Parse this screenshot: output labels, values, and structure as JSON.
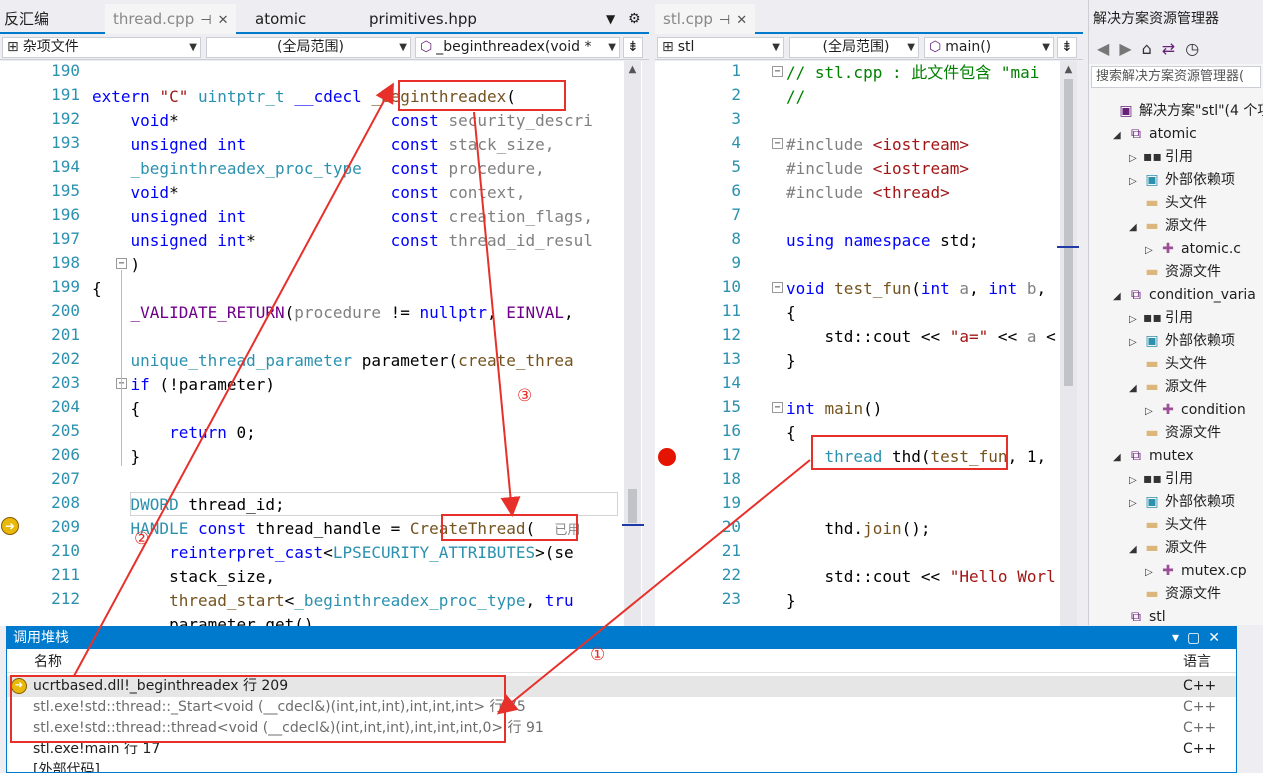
{
  "left_doc": {
    "side_tab": "反汇编",
    "tabs": [
      "thread.cpp",
      "atomic",
      "primitives.hpp"
    ],
    "scope_combo": "杂项文件",
    "range_combo": "(全局范围)",
    "func_combo": "_beginthreadex(void *",
    "line_numbers": [
      "190",
      "191",
      "192",
      "193",
      "194",
      "195",
      "196",
      "197",
      "198",
      "199",
      "200",
      "201",
      "202",
      "203",
      "204",
      "205",
      "206",
      "207",
      "208",
      "209",
      "210",
      "211",
      "212"
    ],
    "tooltip": "已用"
  },
  "right_doc": {
    "tab": "stl.cpp",
    "scope_combo": "stl",
    "range_combo": "(全局范围)",
    "func_combo": "main()",
    "line_numbers": [
      "1",
      "2",
      "3",
      "4",
      "5",
      "6",
      "7",
      "8",
      "9",
      "10",
      "11",
      "12",
      "13",
      "14",
      "15",
      "16",
      "17",
      "18",
      "19",
      "20",
      "21",
      "22",
      "23"
    ]
  },
  "solution": {
    "title": "解决方案资源管理器",
    "search_placeholder": "搜索解决方案资源管理器(",
    "items": [
      {
        "label": "解决方案\"stl\"(4 个项",
        "icon": "solution-icon"
      },
      {
        "label": "atomic",
        "icon": "project-icon"
      },
      {
        "label": "引用",
        "icon": "references-icon"
      },
      {
        "label": "外部依赖项",
        "icon": "external-deps-icon"
      },
      {
        "label": "头文件",
        "icon": "folder-icon"
      },
      {
        "label": "源文件",
        "icon": "folder-icon"
      },
      {
        "label": "atomic.c",
        "icon": "cpp-file-icon"
      },
      {
        "label": "资源文件",
        "icon": "folder-icon"
      },
      {
        "label": "condition_varia",
        "icon": "project-icon"
      },
      {
        "label": "引用",
        "icon": "references-icon"
      },
      {
        "label": "外部依赖项",
        "icon": "external-deps-icon"
      },
      {
        "label": "头文件",
        "icon": "folder-icon"
      },
      {
        "label": "源文件",
        "icon": "folder-icon"
      },
      {
        "label": "condition",
        "icon": "cpp-file-icon"
      },
      {
        "label": "资源文件",
        "icon": "folder-icon"
      },
      {
        "label": "mutex",
        "icon": "project-icon"
      },
      {
        "label": "引用",
        "icon": "references-icon"
      },
      {
        "label": "外部依赖项",
        "icon": "external-deps-icon"
      },
      {
        "label": "头文件",
        "icon": "folder-icon"
      },
      {
        "label": "源文件",
        "icon": "folder-icon"
      },
      {
        "label": "mutex.cp",
        "icon": "cpp-file-icon"
      },
      {
        "label": "资源文件",
        "icon": "folder-icon"
      },
      {
        "label": "stl",
        "icon": "project-icon"
      }
    ],
    "right_fragments": [
      "项",
      "p"
    ]
  },
  "callstack": {
    "title": "调用堆栈",
    "col_name": "名称",
    "col_lang": "语言",
    "rows": [
      {
        "name": "ucrtbased.dll!_beginthreadex 行 209",
        "lang": "C++"
      },
      {
        "name": "stl.exe!std::thread::_Start<void (__cdecl&)(int,int,int),int,int,int> 行 75",
        "lang": "C++"
      },
      {
        "name": "stl.exe!std::thread::thread<void (__cdecl&)(int,int,int),int,int,int,0> 行 91",
        "lang": "C++"
      },
      {
        "name": "stl.exe!main 行 17",
        "lang": "C++"
      },
      {
        "name": "[外部代码]",
        "lang": ""
      }
    ]
  },
  "annotations": {
    "one": "①",
    "two": "②",
    "three": "③"
  },
  "colors": {
    "accent": "#007acc",
    "annotation": "#e8302a",
    "breakpoint": "#e51400"
  }
}
